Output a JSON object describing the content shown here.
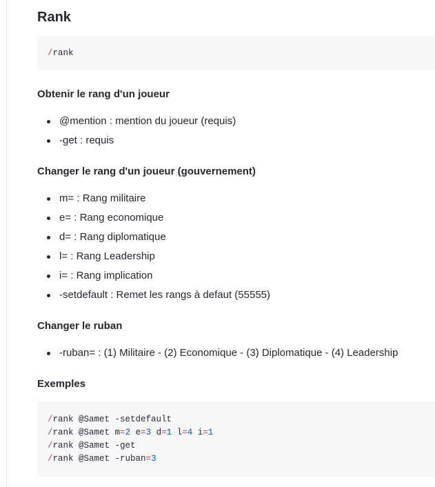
{
  "title": "Rank",
  "command_block": {
    "lines": [
      [
        {
          "t": "/",
          "k": "cmd"
        },
        {
          "t": "rank",
          "k": "plain"
        }
      ]
    ]
  },
  "sections": [
    {
      "heading": "Obtenir le rang d'un joueur",
      "items": [
        "@mention : mention du joueur (requis)",
        "-get : requis"
      ]
    },
    {
      "heading": "Changer le rang d'un joueur (gouvernement)",
      "items": [
        "m= : Rang militaire",
        "e= : Rang economique",
        "d= : Rang diplomatique",
        "l= : Rang Leadership",
        "i= : Rang implication",
        "-setdefault : Remet les rangs à defaut (55555)"
      ]
    },
    {
      "heading": "Changer le ruban",
      "items": [
        "-ruban= : (1) Militaire - (2) Economique - (3) Diplomatique - (4) Leadership"
      ]
    }
  ],
  "examples": {
    "heading": "Exemples",
    "lines": [
      [
        {
          "t": "/",
          "k": "cmd"
        },
        {
          "t": "rank @Samet -setdefault",
          "k": "plain"
        }
      ],
      [
        {
          "t": "/",
          "k": "cmd"
        },
        {
          "t": "rank @Samet m",
          "k": "plain"
        },
        {
          "t": "=",
          "k": "cmd"
        },
        {
          "t": "2",
          "k": "num"
        },
        {
          "t": " e",
          "k": "plain"
        },
        {
          "t": "=",
          "k": "cmd"
        },
        {
          "t": "3",
          "k": "num"
        },
        {
          "t": " d",
          "k": "plain"
        },
        {
          "t": "=",
          "k": "cmd"
        },
        {
          "t": "1",
          "k": "num"
        },
        {
          "t": " l",
          "k": "plain"
        },
        {
          "t": "=",
          "k": "cmd"
        },
        {
          "t": "4",
          "k": "num"
        },
        {
          "t": " i",
          "k": "plain"
        },
        {
          "t": "=",
          "k": "cmd"
        },
        {
          "t": "1",
          "k": "num"
        }
      ],
      [
        {
          "t": "/",
          "k": "cmd"
        },
        {
          "t": "rank @Samet -get",
          "k": "plain"
        }
      ],
      [
        {
          "t": "/",
          "k": "cmd"
        },
        {
          "t": "rank @Samet -ruban",
          "k": "plain"
        },
        {
          "t": "=",
          "k": "cmd"
        },
        {
          "t": "3",
          "k": "num"
        }
      ]
    ]
  },
  "colors": {
    "text": "#24292e",
    "code_bg": "#f6f8fa",
    "syntax_operator": "#d73a49",
    "syntax_number": "#005cc5"
  }
}
